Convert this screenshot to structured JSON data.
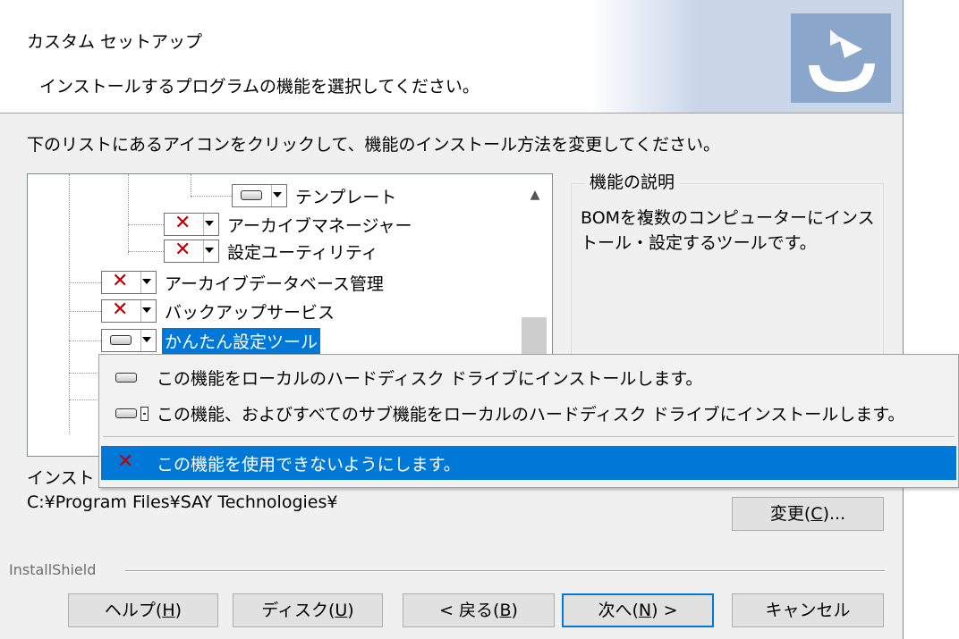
{
  "header": {
    "title": "カスタム セットアップ",
    "subtitle": "インストールするプログラムの機能を選択してください。"
  },
  "instruction": "下のリストにあるアイコンをクリックして、機能のインストール方法を変更してください。",
  "tree": {
    "items": [
      {
        "label": "テンプレート",
        "state": "install"
      },
      {
        "label": "アーカイブマネージャー",
        "state": "unavailable"
      },
      {
        "label": "設定ユーティリティ",
        "state": "unavailable"
      },
      {
        "label": "アーカイブデータベース管理",
        "state": "unavailable"
      },
      {
        "label": "バックアップサービス",
        "state": "unavailable"
      },
      {
        "label": "かんたん設定ツール",
        "state": "install",
        "selected": true
      }
    ]
  },
  "description": {
    "legend": "機能の説明",
    "text": "BOMを複数のコンピューターにインストール・設定するツールです。"
  },
  "install_dir": {
    "label": "インスト",
    "path": "C:¥Program Files¥SAY Technologies¥",
    "change_button": {
      "text": "変更(",
      "key": "C",
      "suffix": ")..."
    }
  },
  "brand": "InstallShield",
  "buttons": {
    "help": {
      "text": "ヘルプ(",
      "key": "H",
      "suffix": ")"
    },
    "disk": {
      "text": "ディスク(",
      "key": "U",
      "suffix": ")"
    },
    "back": {
      "text": "< 戻る(",
      "key": "B",
      "suffix": ")"
    },
    "next": {
      "text": "次へ(",
      "key": "N",
      "suffix": ") >"
    },
    "cancel": {
      "text": "キャンセル"
    }
  },
  "popup_menu": [
    {
      "label": "この機能をローカルのハードディスク ドライブにインストールします。",
      "icon": "drive-icon"
    },
    {
      "label": "この機能、およびすべてのサブ機能をローカルのハードディスク ドライブにインストールします。",
      "icon": "drive-with-subfeatures-icon"
    },
    {
      "label": "この機能を使用できないようにします。",
      "icon": "unavailable-x-icon",
      "highlighted": true
    }
  ],
  "colors": {
    "accent": "#0078d7",
    "unavailable_x": "#c00000",
    "dialog_bg": "#f0f0f0"
  }
}
